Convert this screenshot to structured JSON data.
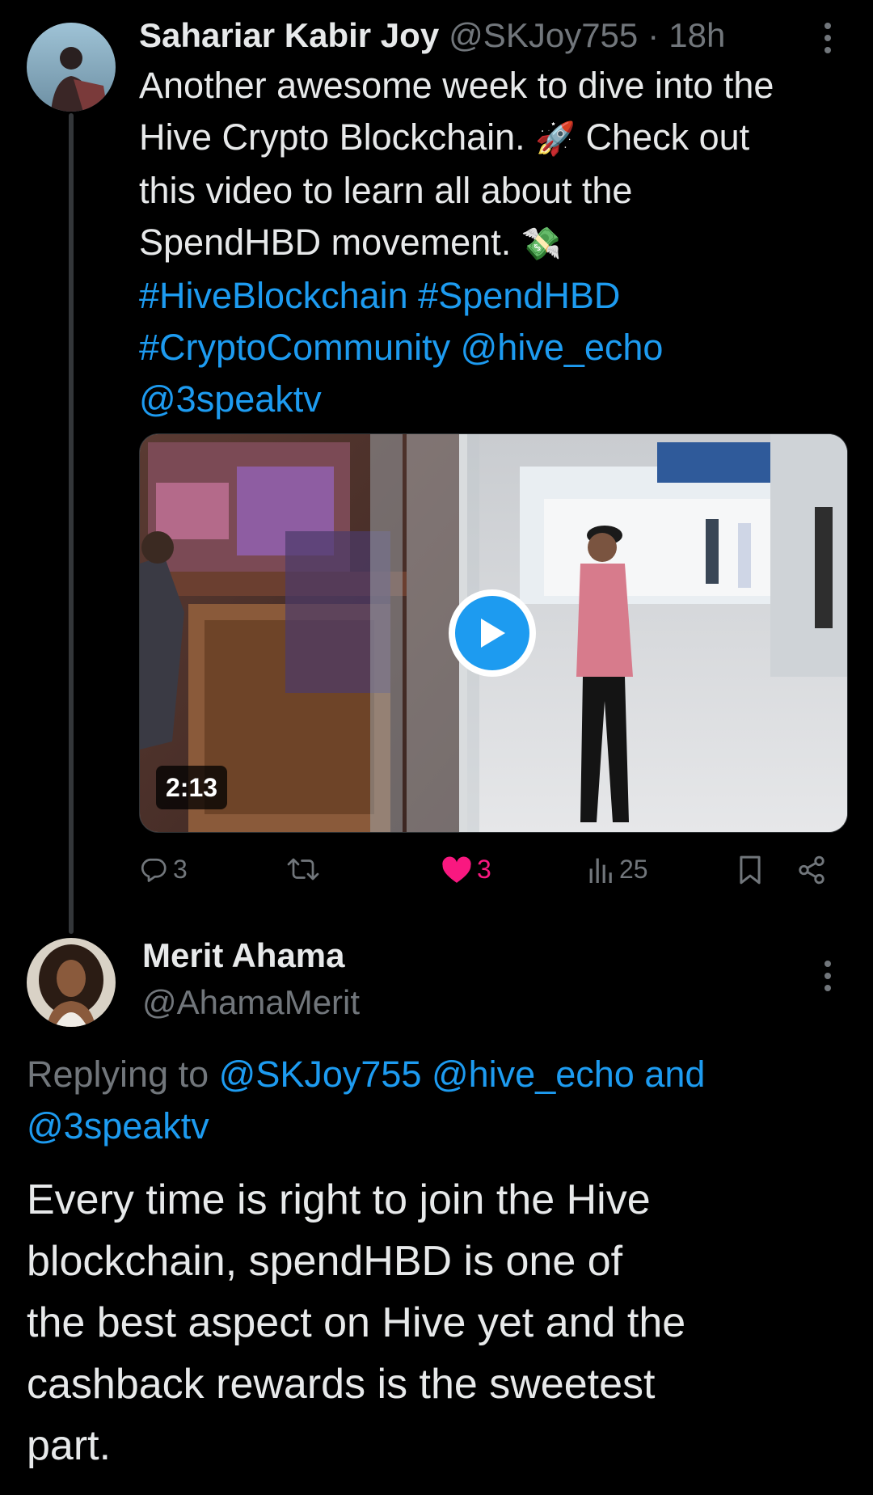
{
  "tweet": {
    "author_name": "Sahariar Kabir Joy",
    "author_handle": "@SKJoy755",
    "separator": "·",
    "time": "18h",
    "text_line1": "Another awesome week to dive into the",
    "text_line2a": "Hive Crypto Blockchain.",
    "text_line2b": "Check out",
    "text_line3": "this video to learn all about the",
    "text_line4": "SpendHBD movement.",
    "emoji_rocket": "🚀",
    "emoji_money": "💸",
    "hashtags_line1": "#HiveBlockchain #SpendHBD",
    "hashtags_line2": "#CryptoCommunity @hive_echo",
    "mention_line3": "@3speaktv",
    "video": {
      "duration": "2:13"
    },
    "actions": {
      "replies": "3",
      "likes": "3",
      "views": "25"
    },
    "colors": {
      "like": "#f91880",
      "link": "#1d9bf0",
      "play_button": "#1d9bf0"
    }
  },
  "reply": {
    "author_name": "Merit Ahama",
    "author_handle": "@AhamaMerit",
    "replying_prefix": "Replying to",
    "replying_mentions_line1": "@SKJoy755 @hive_echo and",
    "replying_mentions_line2": "@3speaktv",
    "text_line1": "Every time is right to join the Hive",
    "text_line2": "blockchain, spendHBD is one of",
    "text_line3": "the best aspect on Hive yet and the",
    "text_line4": "cashback rewards is the sweetest",
    "text_line5": "part."
  }
}
